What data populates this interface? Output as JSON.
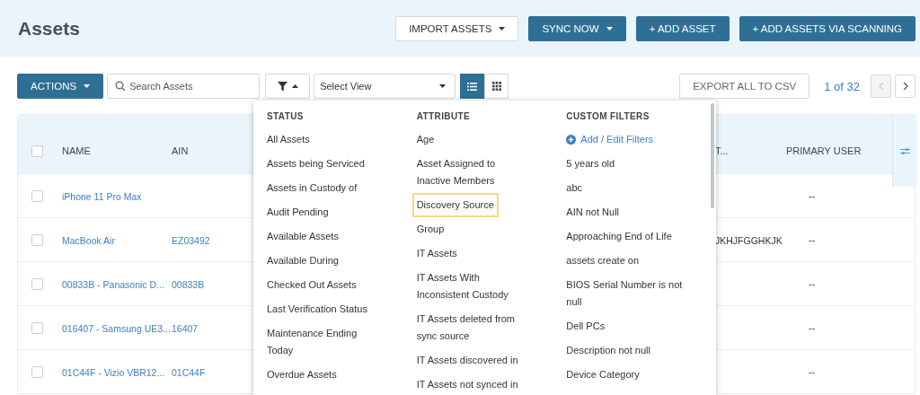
{
  "page_title": "Assets",
  "header_buttons": [
    {
      "label": "IMPORT ASSETS",
      "kind": "outline",
      "caret": true
    },
    {
      "label": "SYNC NOW",
      "kind": "primary",
      "caret": true
    },
    {
      "label": "+ ADD ASSET",
      "kind": "primary",
      "caret": false
    },
    {
      "label": "+ ADD ASSETS VIA SCANNING",
      "kind": "primary",
      "caret": false
    }
  ],
  "toolbar": {
    "actions_button": "ACTIONS",
    "search": {
      "placeholder": "Search Assets"
    },
    "filter_expanded": true,
    "view_select": "Select View",
    "view_modes": [
      {
        "kind": "list",
        "selected": true
      },
      {
        "kind": "grid",
        "selected": false
      }
    ],
    "export_button": "EXPORT ALL TO CSV",
    "pager": {
      "text": "1 of 32",
      "prev_disabled": true,
      "next_disabled": false
    }
  },
  "table": {
    "header_checked": false,
    "columns": [
      "NAME",
      "AIN",
      "T...",
      "PRIMARY USER"
    ],
    "rows": [
      {
        "checked": false,
        "name": "iPhone 11 Pro Max",
        "ain": "",
        "column_3": "",
        "primary_user": "--"
      },
      {
        "checked": false,
        "name": "MacBook Air",
        "ain": "EZ03492",
        "column_3": "JKHJFGGHKJK",
        "primary_user": "--"
      },
      {
        "checked": false,
        "name": "00833B - Panasonic D...",
        "ain": "00833B",
        "column_3": "",
        "primary_user": "--"
      },
      {
        "checked": false,
        "name": "016407 - Samsung UE3...",
        "ain": "16407",
        "column_3": "",
        "primary_user": "--"
      },
      {
        "checked": false,
        "name": "01C44F - Vizio VBR12...",
        "ain": "01C44F",
        "column_3": "",
        "primary_user": "--"
      }
    ]
  },
  "filter_menu": {
    "columns": [
      {
        "title": "STATUS",
        "items": [
          {
            "label": "All Assets",
            "kind": "filter",
            "focused": false
          },
          {
            "label": "Assets being Serviced",
            "kind": "filter",
            "focused": false
          },
          {
            "label": "Assets in Custody of",
            "kind": "filter",
            "focused": false
          },
          {
            "label": "Audit Pending",
            "kind": "filter",
            "focused": false
          },
          {
            "label": "Available Assets",
            "kind": "filter",
            "focused": false
          },
          {
            "label": "Available During",
            "kind": "filter",
            "focused": false
          },
          {
            "label": "Checked Out Assets",
            "kind": "filter",
            "focused": false
          },
          {
            "label": "Last Verification Status",
            "kind": "filter",
            "focused": false
          },
          {
            "label": "Maintenance Ending Today",
            "kind": "filter",
            "focused": false
          },
          {
            "label": "Overdue Assets",
            "kind": "filter",
            "focused": false
          }
        ]
      },
      {
        "title": "ATTRIBUTE",
        "items": [
          {
            "label": "Age",
            "kind": "filter",
            "focused": false
          },
          {
            "label": "Asset Assigned to Inactive Members",
            "kind": "filter",
            "focused": false
          },
          {
            "label": "Discovery Source",
            "kind": "filter",
            "focused": true
          },
          {
            "label": "Group",
            "kind": "filter",
            "focused": false
          },
          {
            "label": "IT Assets",
            "kind": "filter",
            "focused": false
          },
          {
            "label": "IT Assets With Inconsistent Custody",
            "kind": "filter",
            "focused": false
          },
          {
            "label": "IT Assets deleted from sync source",
            "kind": "filter",
            "focused": false
          },
          {
            "label": "IT Assets discovered in",
            "kind": "filter",
            "focused": false
          },
          {
            "label": "IT Assets not synced in",
            "kind": "filter",
            "focused": false
          }
        ]
      },
      {
        "title": "CUSTOM FILTERS",
        "items": [
          {
            "label": "Add / Edit Filters",
            "kind": "action",
            "focused": false
          },
          {
            "label": "5 years old",
            "kind": "filter",
            "focused": false
          },
          {
            "label": "abc",
            "kind": "filter",
            "focused": false
          },
          {
            "label": "AIN not Null",
            "kind": "filter",
            "focused": false
          },
          {
            "label": "Approaching End of Life",
            "kind": "filter",
            "focused": false
          },
          {
            "label": "assets create on",
            "kind": "filter",
            "focused": false
          },
          {
            "label": "BIOS Serial Number is not null",
            "kind": "filter",
            "focused": false
          },
          {
            "label": "Dell PCs",
            "kind": "filter",
            "focused": false
          },
          {
            "label": "Description not null",
            "kind": "filter",
            "focused": false
          },
          {
            "label": "Device Category",
            "kind": "filter",
            "focused": false
          }
        ]
      }
    ]
  }
}
